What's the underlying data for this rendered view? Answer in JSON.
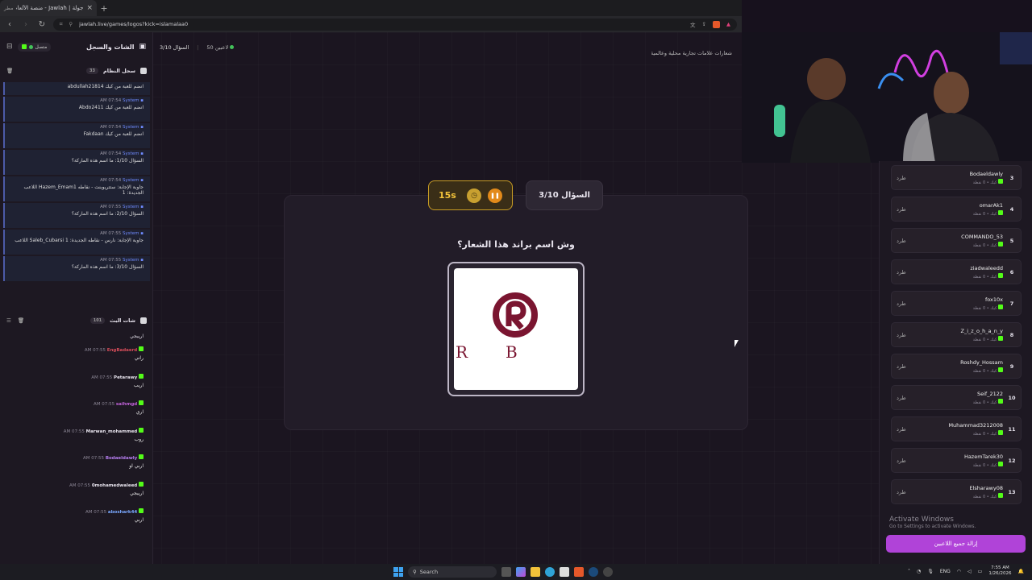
{
  "browser": {
    "tab_title": "جولة | Jawlah - منصة الألعاب التف...",
    "tab_badge": "مطر",
    "url": "jawlah.live/games/logos?kick=islamalaa0"
  },
  "left_panel": {
    "title": "الشات والسجل",
    "status": "متصل",
    "system_log": {
      "title": "سجل النظام",
      "count": "33",
      "first_line": "abdullah21814 انضم للعبة من كيك",
      "messages": [
        {
          "sender": "System",
          "time": "AM 07:54",
          "text": "Abdo2411 انضم للعبة من كيك"
        },
        {
          "sender": "System",
          "time": "AM 07:54",
          "text": "Fakdaan انضم للعبة من كيك"
        },
        {
          "sender": "System",
          "time": "AM 07:54",
          "text": "السؤال 1/10: ما اسم هذه الماركة؟"
        },
        {
          "sender": "System",
          "time": "AM 07:54",
          "text": "اللاعب Hazem_Emam1 جاوبة الإجابة: ستتريوبنت - نقاطه الجديدة: 1"
        },
        {
          "sender": "System",
          "time": "AM 07:55",
          "text": "السؤال 2/10: ما اسم هذه الماركة؟"
        },
        {
          "sender": "System",
          "time": "AM 07:55",
          "text": "اللاعب Saleb_Cubarsi جاوبة الإجابة: نارس - نقاطه الجديدة: 1"
        },
        {
          "sender": "System",
          "time": "AM 07:55",
          "text": "السؤال 3/10: ما اسم هذه الماركة؟"
        }
      ]
    },
    "stream_chat": {
      "title": "شات البث",
      "count": "101",
      "first_line": "اريبجي",
      "messages": [
        {
          "user": "EngBadaerd",
          "time": "AM 07:55",
          "text": "راني",
          "color": "#d64d5a"
        },
        {
          "user": "Petarawy",
          "time": "AM 07:55",
          "text": "اريب",
          "color": "#e8e4ee"
        },
        {
          "user": "saihmgd",
          "time": "AM 07:55",
          "text": "اري",
          "color": "#c062d8"
        },
        {
          "user": "Marwan_mohammed",
          "time": "AM 07:55",
          "text": "روب",
          "color": "#e8e4ee"
        },
        {
          "user": "Bodaeldawly",
          "time": "AM 07:55",
          "text": "اربي او",
          "color": "#b67ef0"
        },
        {
          "user": "0mohamedwaleed",
          "time": "AM 07:55",
          "text": "اريبجي",
          "color": "#e8e4ee"
        },
        {
          "user": "aboshark44",
          "time": "AM 07:55",
          "text": "اربي",
          "color": "#7aa8ff"
        }
      ]
    }
  },
  "game": {
    "players_online": "50 لاعبين",
    "question_counter_small": "السؤال 3/10",
    "category": "شعارات علامات تجارية محلية وعالمية",
    "timer": "15s",
    "question_badge": "السؤال 3/10",
    "question": "وش اسم براند هذا الشعار؟",
    "logo_letters": [
      "R",
      "B"
    ],
    "logo_color": "#7a1530",
    "accent": "#c89c24"
  },
  "leaderboard": {
    "kick_label": "طرد",
    "points_label": "كيك • 0 نقطة",
    "players": [
      {
        "rank": "3",
        "name": "Bodaeldawly"
      },
      {
        "rank": "4",
        "name": "omarAk1"
      },
      {
        "rank": "5",
        "name": "COMMANDO_53"
      },
      {
        "rank": "6",
        "name": "ziadwaleedd"
      },
      {
        "rank": "7",
        "name": "fox10x"
      },
      {
        "rank": "8",
        "name": "Z_i_z_o_h_a_n_y"
      },
      {
        "rank": "9",
        "name": "Roshdy_Hossam"
      },
      {
        "rank": "10",
        "name": "Seif_2122"
      },
      {
        "rank": "11",
        "name": "Muhammad3212008"
      },
      {
        "rank": "12",
        "name": "HazemTarek30"
      },
      {
        "rank": "13",
        "name": "Elsharawy08"
      }
    ],
    "remove_all": "إزالة جميع اللاعبين"
  },
  "windows": {
    "activate_title": "Activate Windows",
    "activate_sub": "Go to Settings to activate Windows.",
    "search": "Search",
    "lang": "ENG",
    "time": "7:55 AM",
    "date": "1/26/2026"
  }
}
